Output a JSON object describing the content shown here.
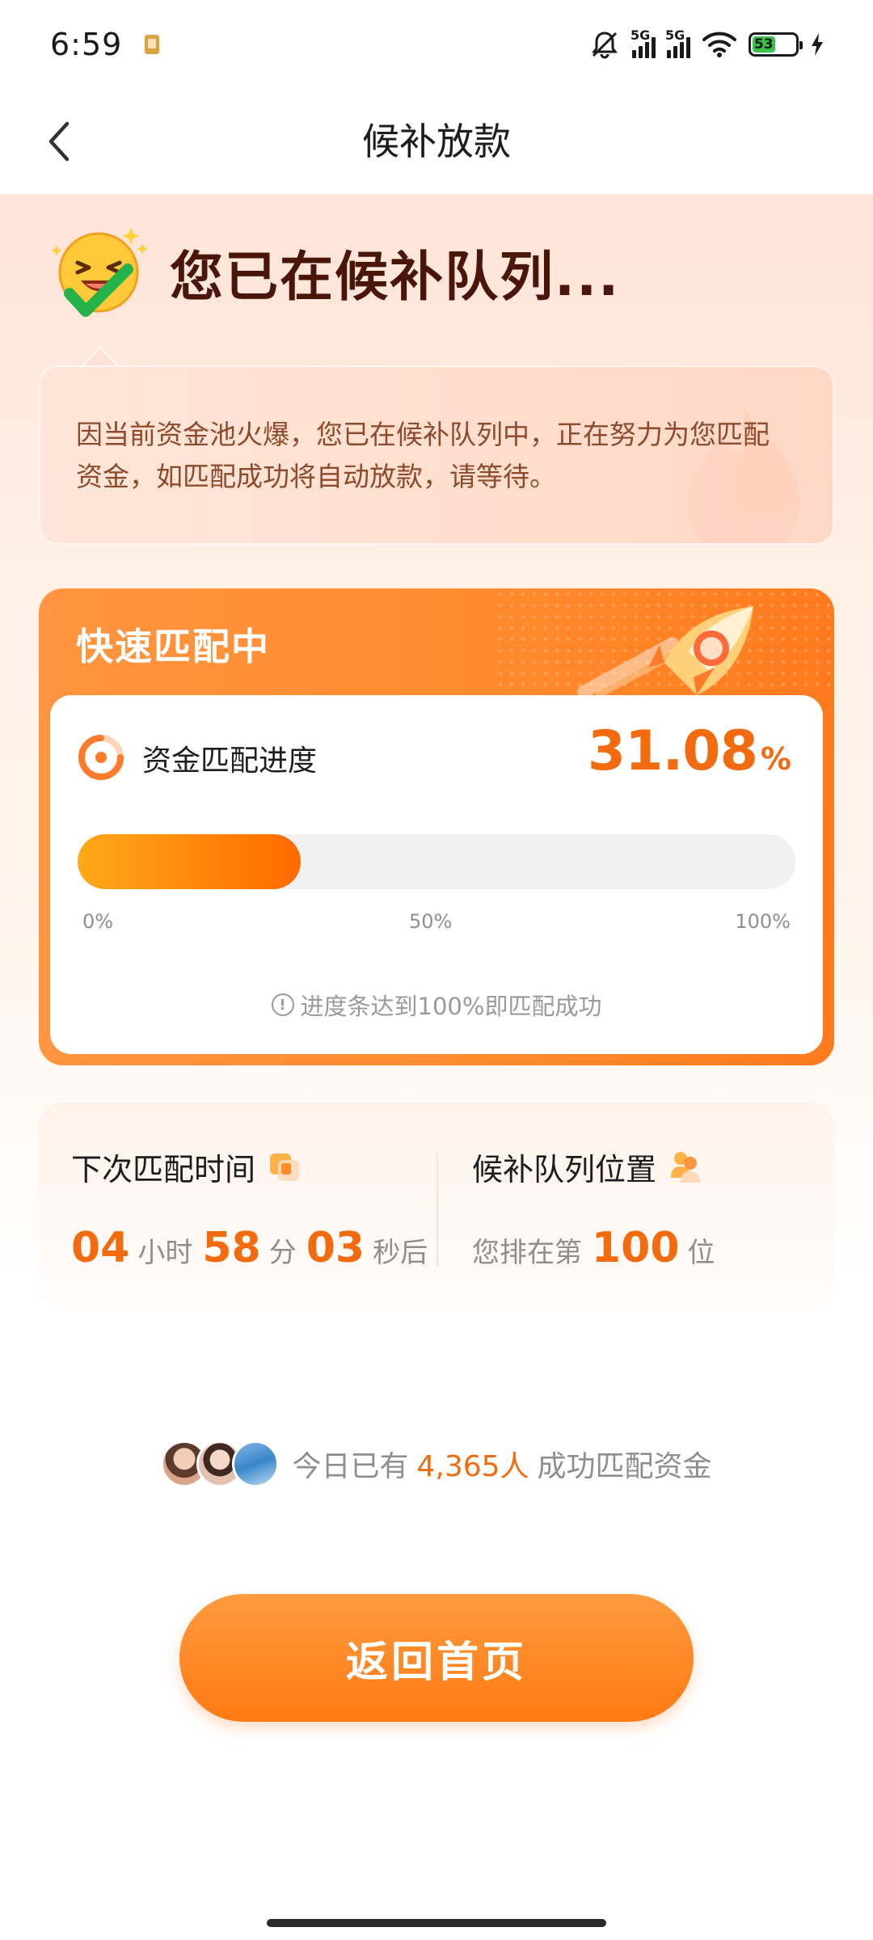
{
  "status_bar": {
    "time": "6:59",
    "network_label": "5G",
    "network_label_2": "5G",
    "battery_level": "53",
    "battery_color": "#39c24a"
  },
  "nav": {
    "title": "候补放款",
    "back_icon": "chevron-left-icon"
  },
  "hero": {
    "title": "您已在候补队列...",
    "icon": "laughing-check-emoji-icon"
  },
  "notice": {
    "text": "因当前资金池火爆，您已在候补队列中，正在努力为您匹配资金，如匹配成功将自动放款，请等待。"
  },
  "match_card": {
    "title": "快速匹配中",
    "progress_label": "资金匹配进度",
    "progress_value": "31.08",
    "progress_unit": "%",
    "progress_fraction": 0.3108,
    "ticks": [
      "0%",
      "50%",
      "100%"
    ],
    "note": "进度条达到100%即匹配成功",
    "accent_color": "#f26b0f"
  },
  "timer": {
    "next_match_title": "下次匹配时间",
    "hours": "04",
    "hours_unit": "小时",
    "minutes": "58",
    "minutes_unit": "分",
    "seconds": "03",
    "seconds_unit": "秒后",
    "queue_title": "候补队列位置",
    "queue_prefix": "您排在第",
    "queue_position": "100",
    "queue_suffix": "位"
  },
  "today": {
    "prefix": "今日已有",
    "count": "4,365人",
    "suffix": "成功匹配资金"
  },
  "actions": {
    "return_home": "返回首页"
  }
}
